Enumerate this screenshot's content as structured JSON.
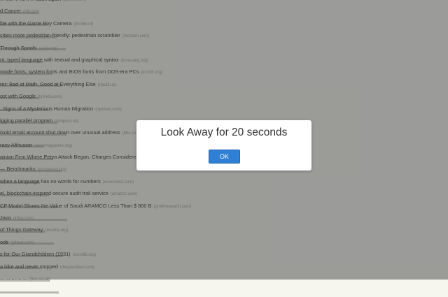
{
  "feed": {
    "items": [
      {
        "title": "... the ... fork ... back again",
        "domain": "(github.com)"
      },
      {
        "title": "d Cancer",
        "domain": "(nih.gov)"
      },
      {
        "title": "file with the Game Boy Camera",
        "domain": "(bitchin.nl)"
      },
      {
        "title": "cities more pedestrian-friendly: pedestrian scrambler",
        "domain": "(medium.com)"
      },
      {
        "title": "Through Spoofs",
        "domain": "(arxiv.org)"
      },
      {
        "title": "nt, typed language with textual and graphical syntax",
        "domain": "(luna-lang.org)"
      },
      {
        "title": "mode fonts, system fonts and BIOS fonts from DOS-era PCs",
        "domain": "(int10h.org)"
      },
      {
        "title": "rer: Bad at Math, Good at Everything Else",
        "domain": "(nautil.us)"
      },
      {
        "title": "ost with Google",
        "domain": "(tymeta.com)"
      },
      {
        "title": ", Signs of a Mysterious Human Migration",
        "domain": "(nytimes.com)"
      },
      {
        "title": "igging parallel program",
        "domain": "(lamport.net)"
      },
      {
        "title": "Gold email account shut down over unusual address",
        "domain": "(bbc.co.uk)"
      },
      {
        "title": "rasy Althusser",
        "domain": "(aeonmagazine.org)"
      },
      {
        "title": "ainian Firm Where Petya Attack Began, Charges Considered",
        "domain": "(ap.org)"
      },
      {
        "title": "— Benchmarks",
        "domain": "(postgresql.org)"
      },
      {
        "title": "when a language has no words for numbers",
        "domain": "(economist.com)"
      },
      {
        "title": "el, blockchain-inspired secure audit trail service",
        "domain": "(amazon.com)"
      },
      {
        "title": "CP Model Shows the Value of Saudi ARAMCO Less Than $ 800 B",
        "domain": "(profitresearch.com)"
      },
      {
        "title": "Java",
        "domain": "(infoq.com)"
      },
      {
        "title": "of Things Gateway",
        "domain": "(mozilla.org)"
      },
      {
        "title": "ode",
        "domain": "(github.com)"
      },
      {
        "title": "s for Our Grandchildren (1931)",
        "domain": "(econlib.org)"
      },
      {
        "title": "a bike and never stopped",
        "domain": "(theguardian.com)"
      },
      {
        "title": "... ... ... ... ...",
        "domain": "(bbc.co.uk)"
      }
    ]
  },
  "dialog": {
    "message": "Look Away for 20 seconds",
    "ok_label": "OK"
  }
}
